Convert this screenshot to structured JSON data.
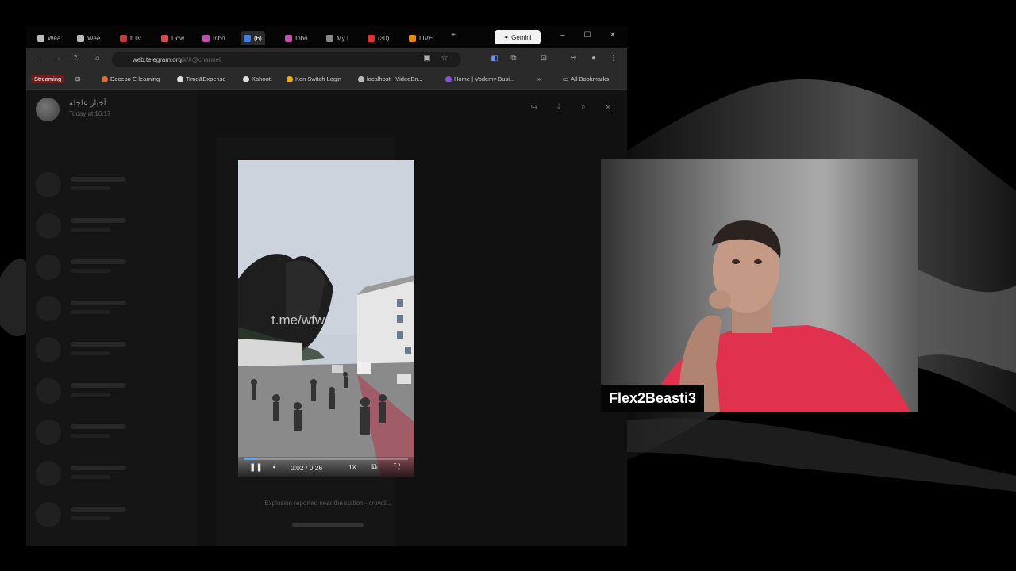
{
  "browser": {
    "tabs": [
      {
        "label": "Wea",
        "color": "#bbbbbb"
      },
      {
        "label": "Wee",
        "color": "#bbbbbb"
      },
      {
        "label": "fi.liv",
        "color": "#c23b3b"
      },
      {
        "label": "Dow",
        "color": "#d94b4b"
      },
      {
        "label": "Inbo",
        "color": "#c44fb0"
      },
      {
        "label": "(6)",
        "color": "#3f7fe0"
      },
      {
        "label": "Inbo",
        "color": "#c44fb0"
      },
      {
        "label": "My I",
        "color": "#888888"
      },
      {
        "label": "(30)",
        "color": "#e33030"
      },
      {
        "label": "LIVE",
        "color": "#e8870e"
      }
    ],
    "new_tab_icon": "plus-icon",
    "gemini_label": "Gemini",
    "url": "web.telegram.org",
    "url_rest": "/k/#@channel",
    "bookmarks": [
      {
        "label": "Streaming",
        "color": "#e05050"
      },
      {
        "label": "Docebo E-learning",
        "color": "#e07030"
      },
      {
        "label": "Time&Expense",
        "color": "#dddddd"
      },
      {
        "label": "Kahoot!",
        "color": "#dddddd"
      },
      {
        "label": "Kon Switch Login",
        "color": "#f0b000"
      },
      {
        "label": "localhost - VideoEn...",
        "color": "#bbbbbb"
      },
      {
        "label": "Home | Vodemy Busi...",
        "color": "#8a4fe0"
      }
    ],
    "all_bookmarks": "All Bookmarks"
  },
  "telegram": {
    "viewer_name": "أخبار عاجلة",
    "viewer_sub": "Today at 16:17",
    "video": {
      "time": "0:02 / 0:26",
      "speed": "1X",
      "progress": 0.08,
      "watermark_top": "",
      "watermark": "t.me/wfw"
    },
    "caption": "Explosion reported near the station - crowd..."
  },
  "webcam": {
    "name": "Flex2Beasti3"
  }
}
